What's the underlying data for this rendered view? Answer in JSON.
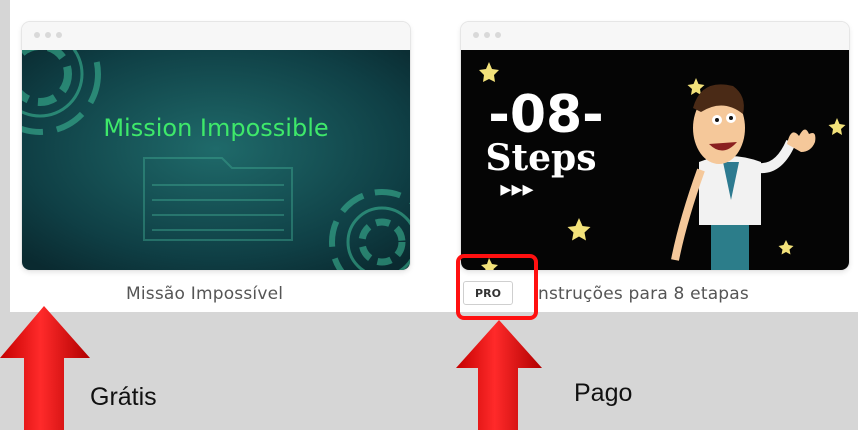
{
  "cards": [
    {
      "title": "Missão Impossível",
      "thumbnail_text": "Mission Impossible",
      "accent": "#3ee86a"
    },
    {
      "title": "nstruções para 8 etapas",
      "thumbnail_line1": "-08-",
      "thumbnail_line2": "Steps",
      "thumbnail_arrows": "▸▸▸",
      "badge": "PRO"
    }
  ],
  "annotations": {
    "free_label": "Grátis",
    "paid_label": "Pago",
    "arrow_color": "#ff1a1a",
    "highlight_color": "#ff1010"
  }
}
